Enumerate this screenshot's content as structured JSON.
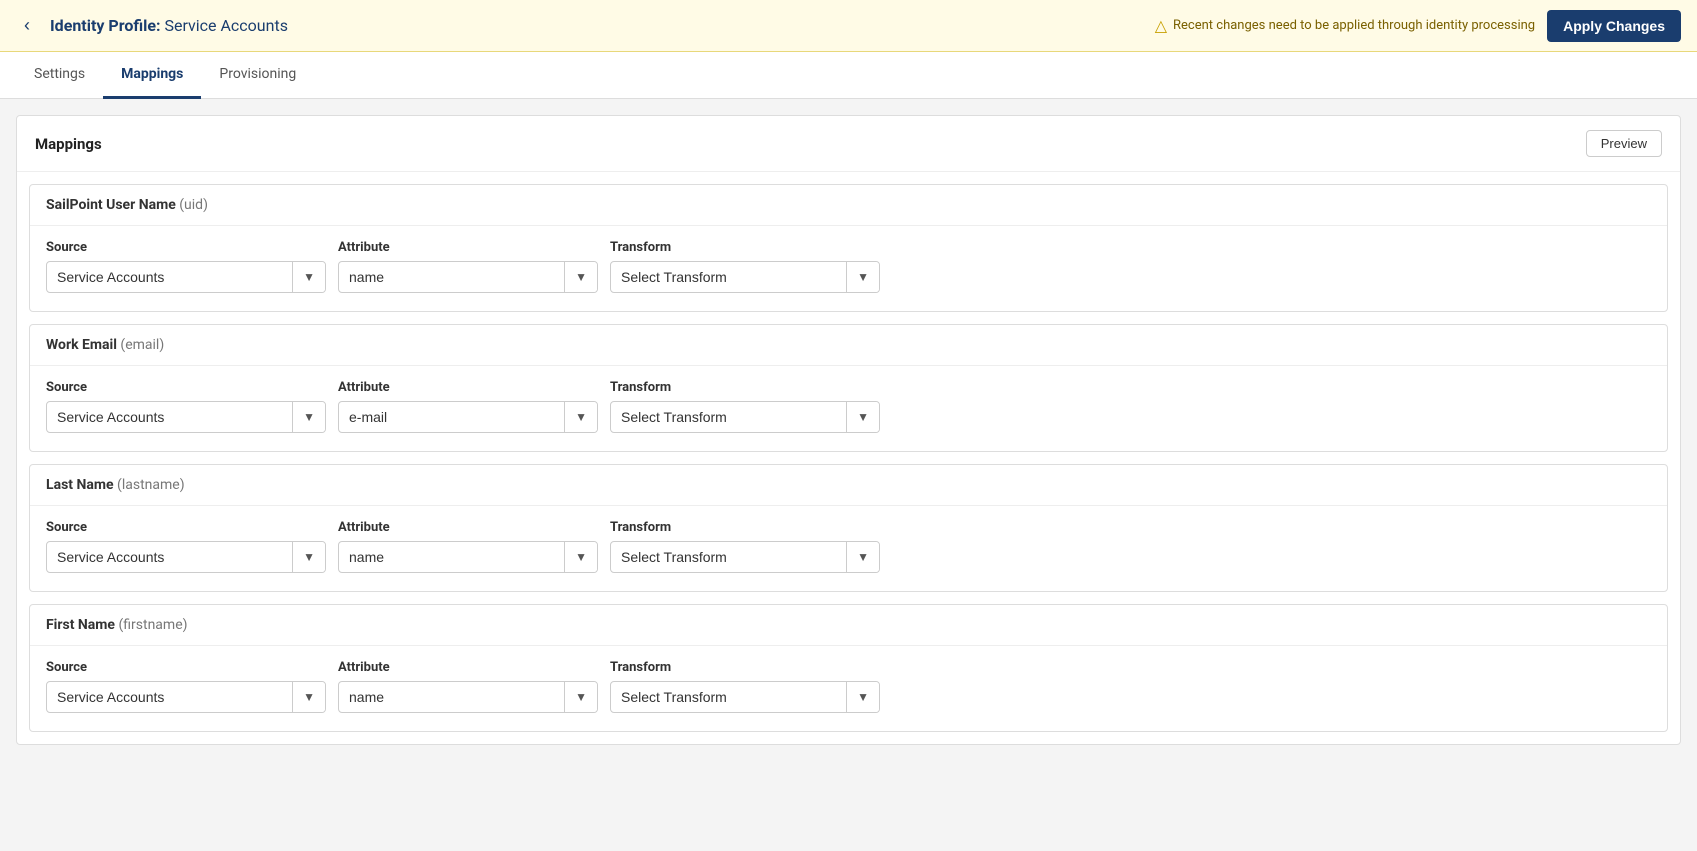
{
  "header": {
    "back_label": "‹",
    "profile_prefix": "Identity Profile:",
    "profile_name": "Service Accounts",
    "warning_text": "Recent changes need to be applied through identity processing",
    "apply_label": "Apply Changes"
  },
  "tabs": [
    {
      "id": "settings",
      "label": "Settings",
      "active": false
    },
    {
      "id": "mappings",
      "label": "Mappings",
      "active": true
    },
    {
      "id": "provisioning",
      "label": "Provisioning",
      "active": false
    }
  ],
  "mappings_section": {
    "title": "Mappings",
    "preview_label": "Preview"
  },
  "mapping_groups": [
    {
      "id": "uid",
      "attr_name": "SailPoint User Name",
      "attr_key": "(uid)",
      "source_label": "Source",
      "attribute_label": "Attribute",
      "transform_label": "Transform",
      "source_value": "Service Accounts",
      "attribute_value": "name",
      "transform_value": "Select Transform"
    },
    {
      "id": "email",
      "attr_name": "Work Email",
      "attr_key": "(email)",
      "source_label": "Source",
      "attribute_label": "Attribute",
      "transform_label": "Transform",
      "source_value": "Service Accounts",
      "attribute_value": "e-mail",
      "transform_value": "Select Transform"
    },
    {
      "id": "lastname",
      "attr_name": "Last Name",
      "attr_key": "(lastname)",
      "source_label": "Source",
      "attribute_label": "Attribute",
      "transform_label": "Transform",
      "source_value": "Service Accounts",
      "attribute_value": "name",
      "transform_value": "Select Transform"
    },
    {
      "id": "firstname",
      "attr_name": "First Name",
      "attr_key": "(firstname)",
      "source_label": "Source",
      "attribute_label": "Attribute",
      "transform_label": "Transform",
      "source_value": "Service Accounts",
      "attribute_value": "name",
      "transform_value": "Select Transform"
    }
  ],
  "colors": {
    "accent": "#1a3d6e",
    "warning": "#c8a000"
  }
}
